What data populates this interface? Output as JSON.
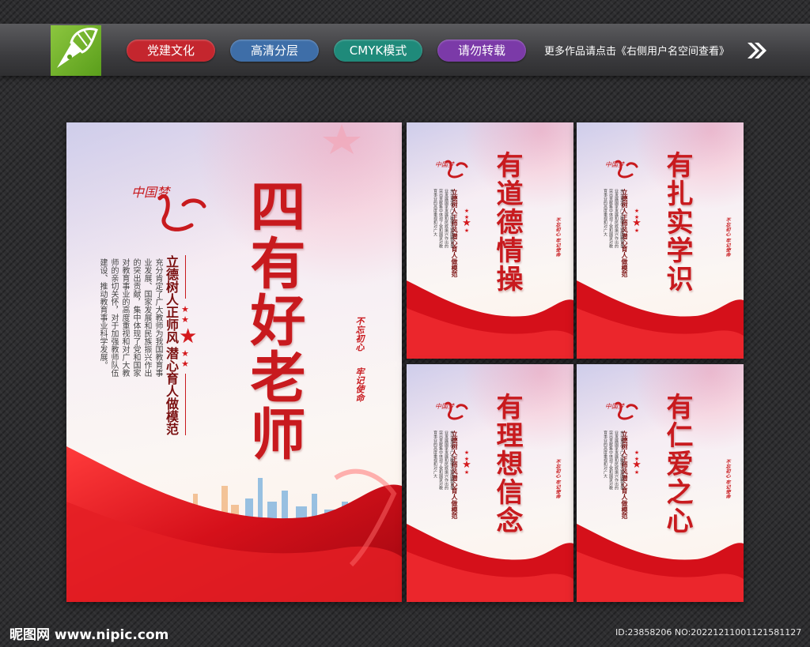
{
  "header": {
    "tags": [
      {
        "label": "党建文化",
        "color": "#c4262e"
      },
      {
        "label": "高清分层",
        "color": "#3e6ea8"
      },
      {
        "label": "CMYK模式",
        "color": "#1f8a7a"
      },
      {
        "label": "请勿转载",
        "color": "#7b3aa8"
      }
    ],
    "note": "更多作品请点击《右侧用户名空间查看》",
    "logo_icon": "pen-nib-icon"
  },
  "main_poster": {
    "title": "四有好老师",
    "slogan_1": "立德树人正师风",
    "slogan_2": "潜心育人做模范",
    "body": "充分肯定了广大教师为我国教育事业发展、国家发展和民族振兴作出的突出贡献，集中体现了党和国家对教育事业的高度重视和对广大教师的亲切关怀，对于加强教师队伍建设、推动教育事业科学发展。",
    "calligraphy": "中国梦",
    "seal_1": "不忘初心",
    "seal_2": "牢记使命"
  },
  "small_posters": [
    {
      "title": "有道德情操"
    },
    {
      "title": "有扎实学识"
    },
    {
      "title": "有理想信念"
    },
    {
      "title": "有仁爱之心"
    }
  ],
  "small_common": {
    "slogan_1": "立德树人正师风",
    "slogan_2": "潜心育人做模范",
    "body": "充分肯定了广大教师为我国教育事业发展国家发展和民族振兴作出的突出贡献集中体现了党和国家对教育事业的高度重视和对广大",
    "calligraphy": "中国梦",
    "seal": "不忘初心  牢记使命"
  },
  "footer": {
    "site": "昵图网 www.nipic.com",
    "id": "ID:23858206 NO:20221211001121581127"
  },
  "colors": {
    "accent_red": "#c81a1e",
    "logo_green": "#7ab52f"
  }
}
